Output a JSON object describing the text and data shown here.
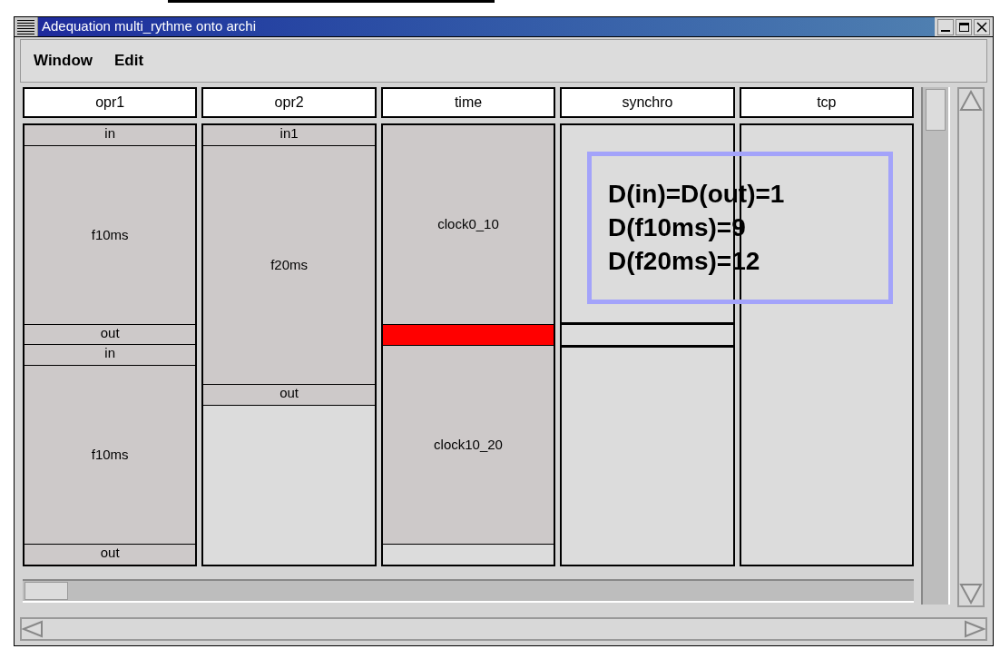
{
  "window": {
    "title": "Adequation multi_rythme onto archi"
  },
  "menu": [
    "Window",
    "Edit"
  ],
  "lanes": [
    {
      "name": "opr1",
      "blocks": [
        {
          "kind": "op",
          "label": "in"
        },
        {
          "kind": "op",
          "label": "f10ms"
        },
        {
          "kind": "op",
          "label": "out"
        },
        {
          "kind": "op",
          "label": "in"
        },
        {
          "kind": "op",
          "label": "f10ms"
        },
        {
          "kind": "op",
          "label": "out"
        }
      ]
    },
    {
      "name": "opr2",
      "blocks": [
        {
          "kind": "op",
          "label": "in1"
        },
        {
          "kind": "op",
          "label": "f20ms"
        },
        {
          "kind": "op",
          "label": "out"
        },
        {
          "kind": "free"
        }
      ]
    },
    {
      "name": "time",
      "blocks": [
        {
          "kind": "op",
          "label": "clock0_10"
        },
        {
          "kind": "marked"
        },
        {
          "kind": "op",
          "label": "clock10_20"
        },
        {
          "kind": "free"
        }
      ]
    },
    {
      "name": "synchro",
      "blocks": [
        {
          "kind": "free"
        },
        {
          "kind": "sync"
        },
        {
          "kind": "free"
        }
      ]
    },
    {
      "name": "tcp",
      "blocks": [
        {
          "kind": "free"
        }
      ]
    }
  ],
  "annotation": {
    "lines": [
      "D(in)=D(out)=1",
      "D(f10ms)=9",
      "D(f20ms)=12"
    ]
  }
}
